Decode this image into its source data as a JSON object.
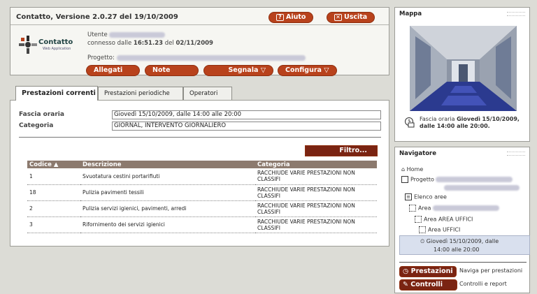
{
  "header": {
    "title": "Contatto, Versione 2.0.27 del 19/10/2009",
    "help_label": "Aiuto",
    "exit_label": "Uscita",
    "logo_name": "Contatto",
    "logo_sub": "Web Application",
    "user_label": "Utente",
    "connected_label": "connesso dalle",
    "connected_time": "16:51.23",
    "connected_date_prefix": "del",
    "connected_date": "02/11/2009",
    "project_label": "Progetto:",
    "buttons": {
      "allegati": "Allegati",
      "note": "Note",
      "segnala": "Segnala",
      "configura": "Configura"
    }
  },
  "tabs": [
    {
      "label": "Prestazioni correnti"
    },
    {
      "label": "Prestazioni periodiche"
    },
    {
      "label": "Operatori"
    }
  ],
  "form": {
    "fascia_label": "Fascia oraria",
    "fascia_value": "Giovedì 15/10/2009, dalle 14:00 alle 20:00",
    "categoria_label": "Categoria",
    "categoria_value": "GIORNAL, INTERVENTO GIORNALIERO",
    "filter_label": "Filtro..."
  },
  "table": {
    "headers": [
      "Codice",
      "Descrizione",
      "Categoria"
    ],
    "rows": [
      {
        "code": "1",
        "desc": "Svuotatura cestini portarifiuti",
        "cat": "RACCHIUDE VARIE PRESTAZIONI NON CLASSIFI"
      },
      {
        "code": "18",
        "desc": "Pulizia pavimenti tessili",
        "cat": "RACCHIUDE VARIE PRESTAZIONI NON CLASSIFI"
      },
      {
        "code": "2",
        "desc": "Pulizia servizi igienici, pavimenti, arredi",
        "cat": "RACCHIUDE VARIE PRESTAZIONI NON CLASSIFI"
      },
      {
        "code": "3",
        "desc": "Rifornimento dei servizi igienici",
        "cat": "RACCHIUDE VARIE PRESTAZIONI NON CLASSIFI"
      }
    ]
  },
  "mappa": {
    "title": "Mappa",
    "caption_prefix": "Fascia oraria",
    "caption_bold": "Giovedì",
    "caption_rest": "15/10/2009, dalle 14:00 alle 20:00."
  },
  "navigatore": {
    "title": "Navigatore",
    "home": "Home",
    "progetto": "Progetto",
    "elenco": "Elenco aree",
    "area": "Area",
    "area_uffici": "Area AREA UFFICI",
    "area_sub": "Area UFFICI",
    "time_line1": "Giovedì 15/10/2009, dalle",
    "time_line2": "14:00 alle 20:00",
    "prestazioni_label": "Prestazioni",
    "prestazioni_desc": "Naviga per prestazioni",
    "controlli_label": "Controlli",
    "controlli_desc": "Controlli e report"
  },
  "colors": {
    "accent": "#b8421c",
    "accent_dark": "#7a2412",
    "header_row": "#8c7a6e"
  }
}
